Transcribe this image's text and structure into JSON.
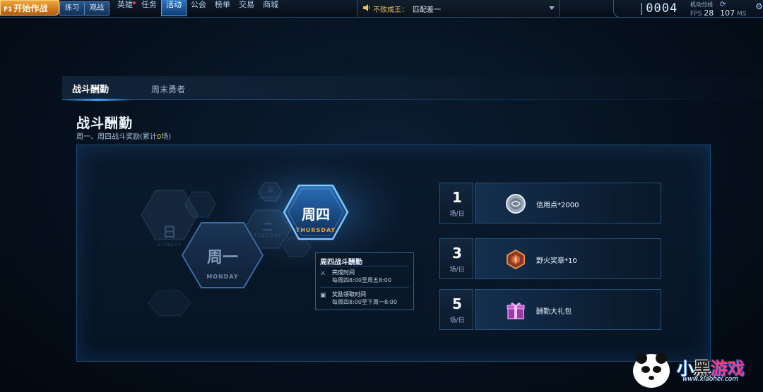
{
  "topbar": {
    "play_label": "开始作战",
    "play_prefix": "F1",
    "practice_label": "练习",
    "spectate_label": "观战",
    "nav": [
      {
        "label": "英雄",
        "badge": true
      },
      {
        "label": "任务",
        "badge": false
      },
      {
        "label": "活动",
        "badge": false,
        "active": true
      },
      {
        "label": "公会",
        "badge": false
      },
      {
        "label": "榜单",
        "badge": false
      },
      {
        "label": "交易",
        "badge": false
      },
      {
        "label": "商城",
        "badge": false
      }
    ],
    "ticker": {
      "name": "不败成王：",
      "message": "匹配差一"
    },
    "status": {
      "counter": "0004",
      "line_label": "机动分线",
      "fps_label": "FPS",
      "fps_value": "28",
      "ping_value": "107",
      "ping_unit": "MS"
    }
  },
  "tabs": [
    {
      "label": "战斗酬勤",
      "active": true
    },
    {
      "label": "周末勇者",
      "active": false
    }
  ],
  "section": {
    "title": "战斗酬勤",
    "subtitle_prefix": "周一、周四战斗奖励(累计",
    "subtitle_count": "0",
    "subtitle_suffix": "场)"
  },
  "days": {
    "sunday": {
      "label": "日",
      "sub": "SUNDAY"
    },
    "monday": {
      "label": "周一",
      "sub": "MONDAY"
    },
    "tuesday": {
      "label": "二",
      "sub": "TUESDAY"
    },
    "wednesday": {
      "label": "三",
      "sub": "WEDNESDAY"
    },
    "thursday": {
      "label": "周四",
      "sub": "THURSDAY"
    }
  },
  "tooltip": {
    "title": "周四战斗酬勤",
    "complete_label": "完成时间",
    "complete_value": "每周四8:00至周五8:00",
    "claim_label": "奖励领取时间",
    "claim_value": "每周四8:00至下周一8:00"
  },
  "rewards": [
    {
      "count": "1",
      "unit": "场/日",
      "name": "信用点*2000",
      "icon": "credit-coin-icon"
    },
    {
      "count": "3",
      "unit": "场/日",
      "name": "野火奖章*10",
      "icon": "wildfire-medal-icon"
    },
    {
      "count": "5",
      "unit": "场/日",
      "name": "酬勤大礼包",
      "icon": "gift-box-icon"
    }
  ],
  "watermark": {
    "text_a": "小",
    "text_b": "黑",
    "text_c": "游戏",
    "url": "www.xiaohei.com"
  },
  "colors": {
    "accent": "#3fa8ff",
    "play_button": "#e08a22",
    "count_highlight": "#ffcc33",
    "thursday_sub": "#f0a33a"
  }
}
